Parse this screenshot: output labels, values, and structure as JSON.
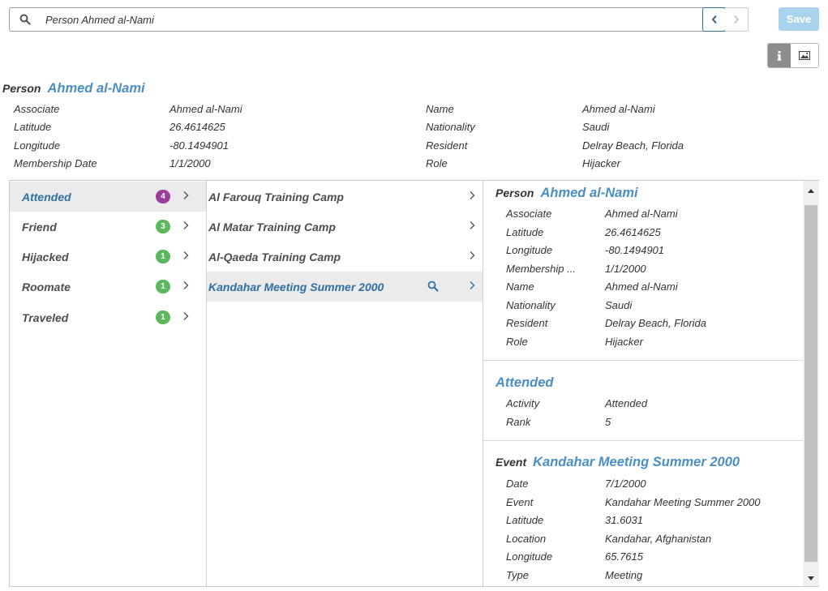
{
  "search": {
    "value": "Person Ahmed al-Nami"
  },
  "toolbar": {
    "save_label": "Save"
  },
  "header": {
    "type": "Person",
    "name": "Ahmed al-Nami",
    "properties": [
      {
        "key": "Associate",
        "value": "Ahmed al-Nami"
      },
      {
        "key": "Latitude",
        "value": "26.4614625"
      },
      {
        "key": "Longitude",
        "value": "-80.1494901"
      },
      {
        "key": "Membership Date",
        "value": "1/1/2000"
      },
      {
        "key": "Name",
        "value": "Ahmed al-Nami"
      },
      {
        "key": "Nationality",
        "value": "Saudi"
      },
      {
        "key": "Resident",
        "value": "Delray Beach, Florida"
      },
      {
        "key": "Role",
        "value": "Hijacker"
      }
    ]
  },
  "relationships": [
    {
      "label": "Attended",
      "count": "4",
      "color": "#9c3e9c",
      "selected": true
    },
    {
      "label": "Friend",
      "count": "3",
      "color": "#5cb85c",
      "selected": false
    },
    {
      "label": "Hijacked",
      "count": "1",
      "color": "#5cb85c",
      "selected": false
    },
    {
      "label": "Roomate",
      "count": "1",
      "color": "#5cb85c",
      "selected": false
    },
    {
      "label": "Traveled",
      "count": "1",
      "color": "#5cb85c",
      "selected": false
    }
  ],
  "entities": [
    {
      "label": "Al Farouq Training Camp",
      "selected": false
    },
    {
      "label": "Al Matar Training Camp",
      "selected": false
    },
    {
      "label": "Al-Qaeda Training Camp",
      "selected": false
    },
    {
      "label": "Kandahar Meeting Summer 2000",
      "selected": true
    }
  ],
  "detail": {
    "person": {
      "type": "Person",
      "name": "Ahmed al-Nami",
      "properties": [
        {
          "key": "Associate",
          "value": "Ahmed al-Nami"
        },
        {
          "key": "Latitude",
          "value": "26.4614625"
        },
        {
          "key": "Longitude",
          "value": "-80.1494901"
        },
        {
          "key": "Membership ...",
          "value": "1/1/2000"
        },
        {
          "key": "Name",
          "value": "Ahmed al-Nami"
        },
        {
          "key": "Nationality",
          "value": "Saudi"
        },
        {
          "key": "Resident",
          "value": "Delray Beach, Florida"
        },
        {
          "key": "Role",
          "value": "Hijacker"
        }
      ]
    },
    "relation": {
      "title": "Attended",
      "properties": [
        {
          "key": "Activity",
          "value": "Attended"
        },
        {
          "key": "Rank",
          "value": "5"
        }
      ]
    },
    "event": {
      "type": "Event",
      "name": "Kandahar Meeting Summer 2000",
      "properties": [
        {
          "key": "Date",
          "value": "7/1/2000"
        },
        {
          "key": "Event",
          "value": "Kandahar Meeting Summer 2000"
        },
        {
          "key": "Latitude",
          "value": "31.6031"
        },
        {
          "key": "Location",
          "value": "Kandahar, Afghanistan"
        },
        {
          "key": "Longitude",
          "value": "65.7615"
        },
        {
          "key": "Type",
          "value": "Meeting"
        }
      ]
    }
  },
  "colors": {
    "accent": "#4a8fc4",
    "selected_text": "#2f6fa3",
    "save_disabled": "#a9d3ec"
  }
}
